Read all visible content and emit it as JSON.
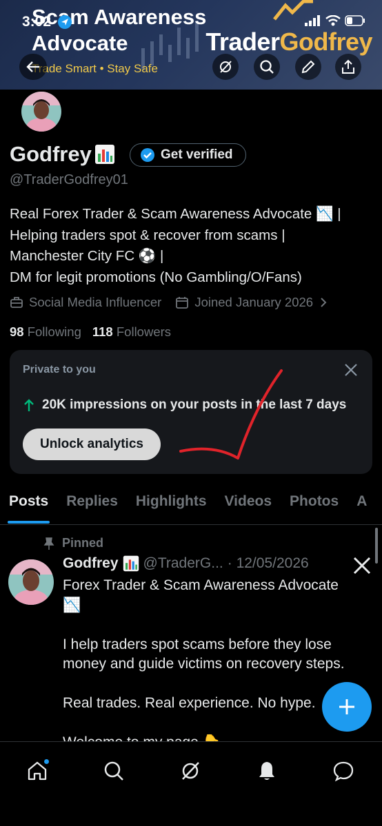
{
  "status": {
    "time": "3:02"
  },
  "banner": {
    "title_line1": "Scam Awareness",
    "title_line2": "Advocate",
    "subtitle": "Trade Smart • Stay Safe",
    "brand_part1": "Trader",
    "brand_part2": "Godfrey"
  },
  "header": {
    "icons": [
      "back-arrow-icon",
      "grok-icon",
      "search-icon",
      "edit-icon",
      "share-icon"
    ]
  },
  "profile": {
    "name": "Godfrey",
    "verify_label": "Get verified",
    "handle": "@TraderGodfrey01",
    "bio_lines": [
      "Real Forex Trader & Scam Awareness Advocate 📉 |",
      "Helping traders spot & recover from scams |",
      "Manchester City FC ⚽ |",
      "DM for legit promotions (No Gambling/O/Fans)"
    ],
    "category": "Social Media Influencer",
    "joined": "Joined January 2026",
    "following_count": "98",
    "following_label": "Following",
    "followers_count": "118",
    "followers_label": "Followers"
  },
  "analytics_card": {
    "title": "Private to you",
    "text": "20K impressions on your posts in the last 7 days",
    "button": "Unlock analytics"
  },
  "tabs": [
    {
      "label": "Posts",
      "active": true
    },
    {
      "label": "Replies"
    },
    {
      "label": "Highlights"
    },
    {
      "label": "Videos"
    },
    {
      "label": "Photos"
    },
    {
      "label": "A"
    }
  ],
  "post": {
    "pinned_label": "Pinned",
    "author": "Godfrey",
    "handle": "@TraderG...",
    "date": "· 12/05/2026",
    "line1": "Forex Trader & Scam Awareness Advocate",
    "line1b": "📉",
    "para2": "I help traders spot scams before they lose money and guide victims on recovery steps.",
    "para3": "Real trades. Real experience. No hype.",
    "para4": "Welcome to my page 👇"
  },
  "colors": {
    "accent": "#1d9bf0",
    "annotation": "#e0232a",
    "gold": "#f0b84a"
  },
  "bottom_nav": [
    "home-icon",
    "search-icon",
    "grok-icon",
    "notifications-icon",
    "messages-icon"
  ]
}
